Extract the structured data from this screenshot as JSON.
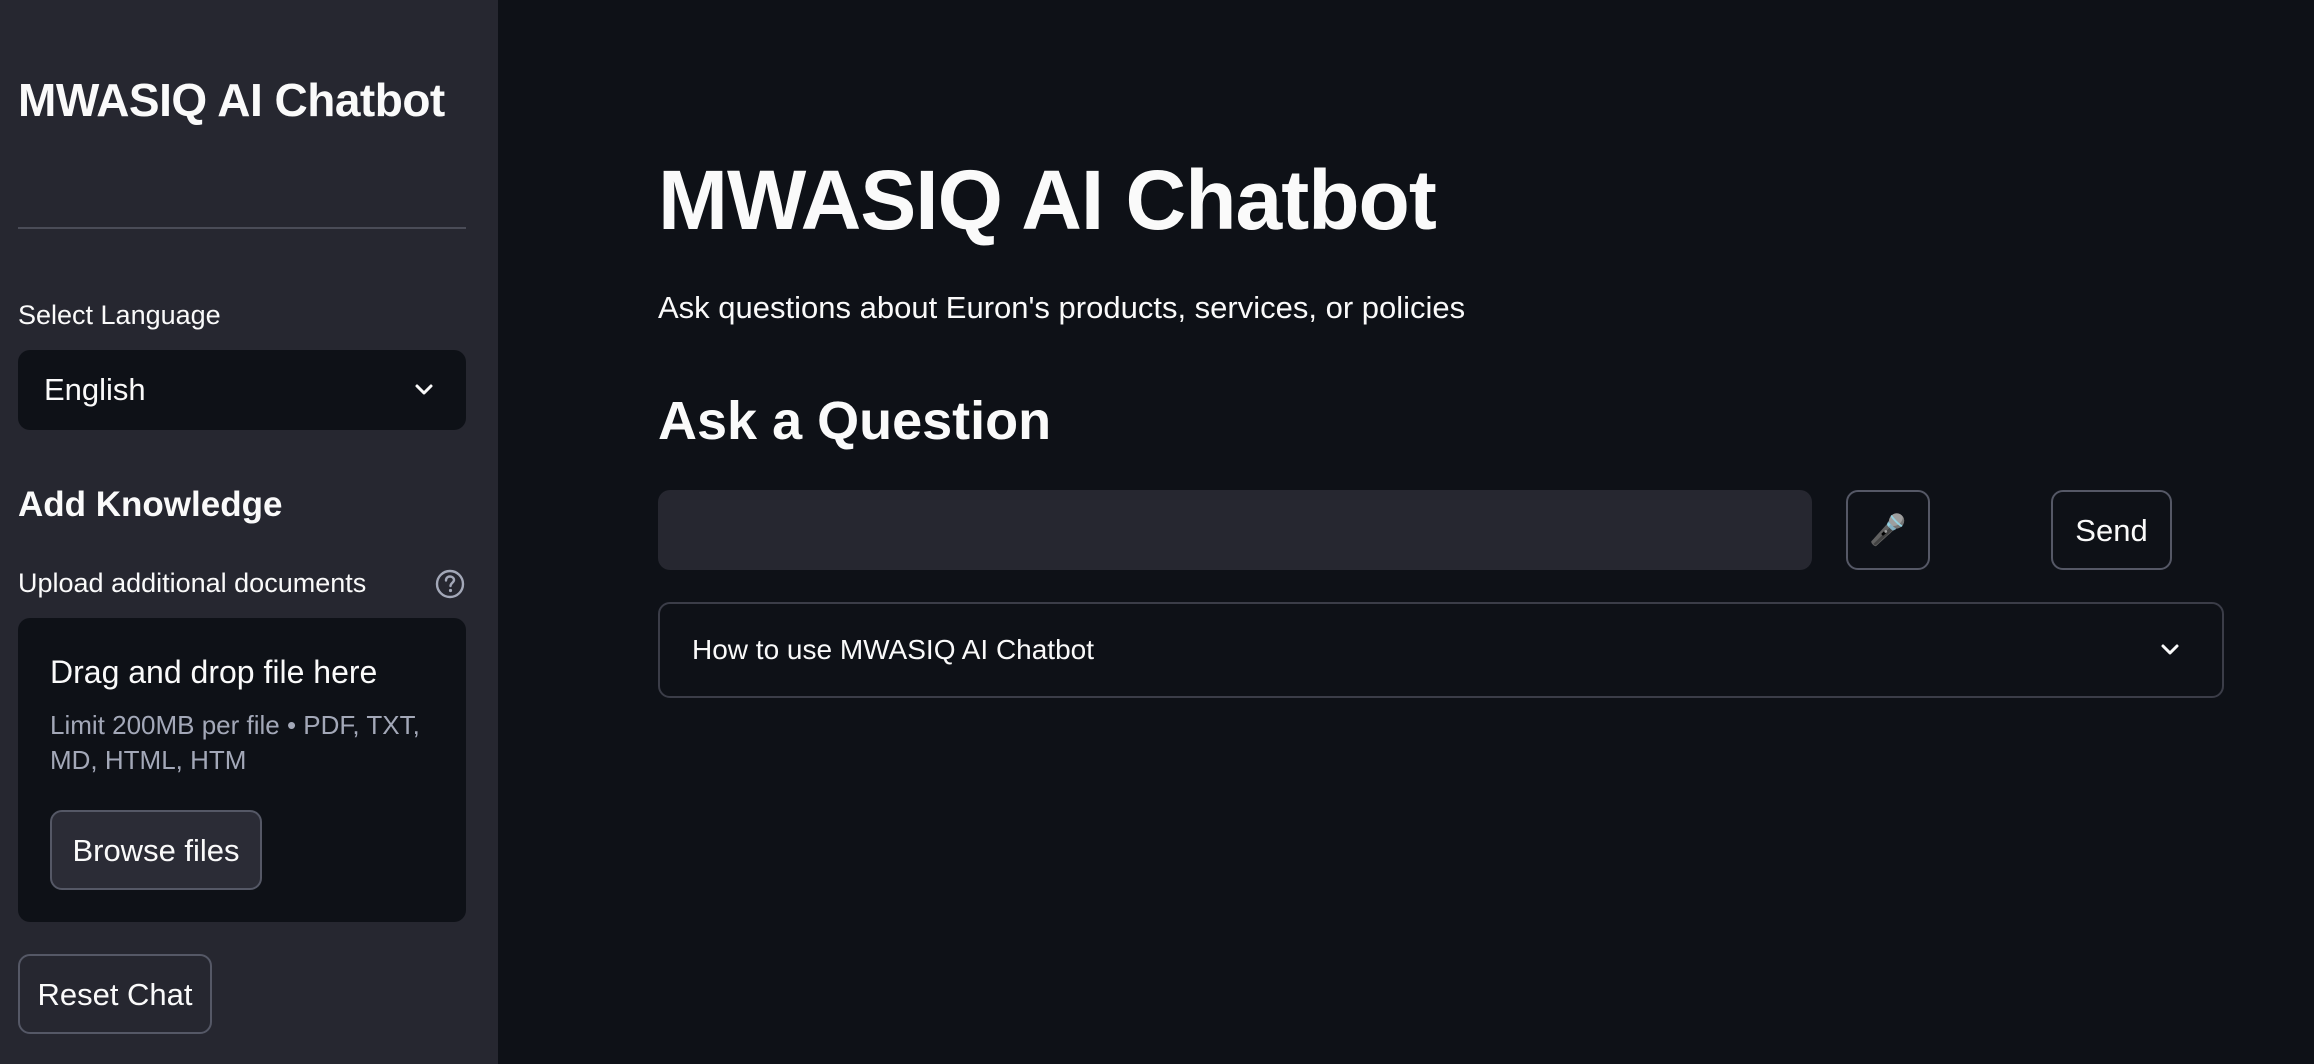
{
  "sidebar": {
    "title": "MWASIQ AI Chatbot",
    "language_label": "Select Language",
    "language_value": "English",
    "knowledge_heading": "Add Knowledge",
    "upload_label": "Upload additional documents",
    "dropzone": {
      "title": "Drag and drop file here",
      "limit": "Limit 200MB per file • PDF, TXT, MD, HTML, HTM",
      "browse_label": "Browse files"
    },
    "reset_label": "Reset Chat"
  },
  "main": {
    "title": "MWASIQ AI Chatbot",
    "subtitle": "Ask questions about Euron's products, services, or policies",
    "section_heading": "Ask a Question",
    "question_input": {
      "value": "",
      "placeholder": ""
    },
    "mic_icon": "🎤",
    "send_label": "Send",
    "expander_label": "How to use MWASIQ AI Chatbot"
  },
  "icons": {
    "language_chevron": "chevron-down-icon",
    "help": "help-circle-icon",
    "microphone": "microphone-icon",
    "expander_chevron": "chevron-down-icon"
  },
  "colors": {
    "main_bg": "#0e1117",
    "sidebar_bg": "#262730",
    "text": "#fafafa",
    "muted_text": "#a3a8b8",
    "input_bg": "#262730",
    "border": "#3b3d48"
  }
}
